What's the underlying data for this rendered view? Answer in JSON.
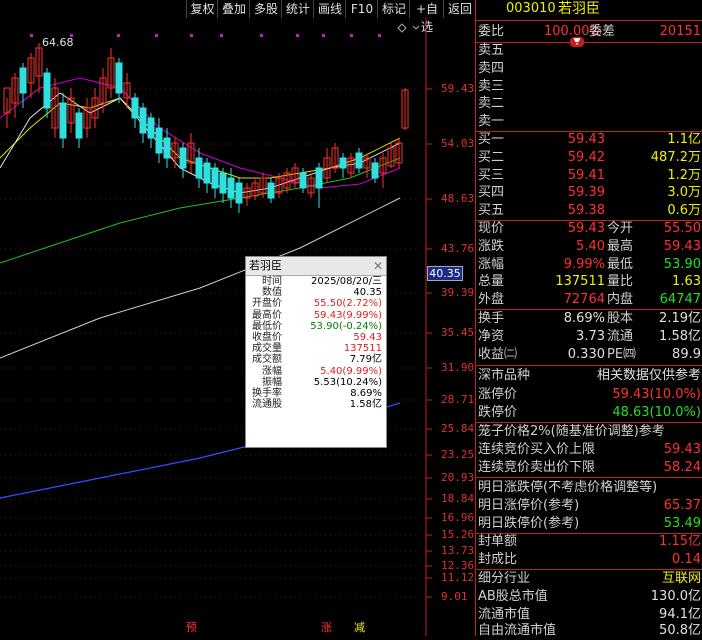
{
  "toolbar": {
    "buttons": [
      "复权",
      "叠加",
      "多股",
      "统计",
      "画线",
      "F10",
      "标记",
      "+自选",
      "返回"
    ]
  },
  "chart": {
    "y_labels": [
      "59.43",
      "54.03",
      "48.63",
      "43.76",
      "39.39",
      "35.45",
      "31.90",
      "28.71",
      "25.84",
      "23.25",
      "20.93",
      "18.84",
      "16.96",
      "15.26",
      "13.73",
      "12.36",
      "11.12",
      "9.01"
    ],
    "current_price": "40.35",
    "high_label": "64.68",
    "markers": [
      {
        "text": "预",
        "color": "#ff3030"
      },
      {
        "text": "涨",
        "color": "#ff3030"
      },
      {
        "text": "减",
        "color": "#f0f000"
      }
    ],
    "tooltip": {
      "title": "若羽臣",
      "rows": [
        {
          "k": "时间",
          "v": "2025/08/20/三",
          "c": "#000"
        },
        {
          "k": "数值",
          "v": "40.35",
          "c": "#000"
        },
        {
          "k": "开盘价",
          "v": "55.50(2.72%)",
          "c": "#e02020"
        },
        {
          "k": "最高价",
          "v": "59.43(9.99%)",
          "c": "#e02020"
        },
        {
          "k": "最低价",
          "v": "53.90(-0.24%)",
          "c": "#008000"
        },
        {
          "k": "收盘价",
          "v": "59.43",
          "c": "#e02020"
        },
        {
          "k": "成交量",
          "v": "137511",
          "c": "#e02020"
        },
        {
          "k": "成交额",
          "v": "7.79亿",
          "c": "#000"
        },
        {
          "k": "涨幅",
          "v": "5.40(9.99%)",
          "c": "#e02020"
        },
        {
          "k": "振幅",
          "v": "5.53(10.24%)",
          "c": "#000"
        },
        {
          "k": "换手率",
          "v": "8.69%",
          "c": "#000"
        },
        {
          "k": "流通股",
          "v": "1.58亿",
          "c": "#000"
        }
      ]
    }
  },
  "panel": {
    "code": "003010",
    "name": "若羽臣",
    "weibi_label": "委比",
    "weibi_value": "100.00%",
    "weicha_label": "委差",
    "weicha_value": "20151",
    "asks": [
      {
        "label": "卖五",
        "price": "",
        "vol": ""
      },
      {
        "label": "卖四",
        "price": "",
        "vol": ""
      },
      {
        "label": "卖三",
        "price": "",
        "vol": ""
      },
      {
        "label": "卖二",
        "price": "",
        "vol": ""
      },
      {
        "label": "卖一",
        "price": "",
        "vol": ""
      }
    ],
    "bids": [
      {
        "label": "买一",
        "price": "59.43",
        "vol": "1.1亿"
      },
      {
        "label": "买二",
        "price": "59.42",
        "vol": "487.2万"
      },
      {
        "label": "买三",
        "price": "59.41",
        "vol": "1.2万"
      },
      {
        "label": "买四",
        "price": "59.39",
        "vol": "3.0万"
      },
      {
        "label": "买五",
        "price": "59.38",
        "vol": "0.6万"
      }
    ],
    "quote": [
      {
        "l1": "现价",
        "v1": "59.43",
        "c1": "red",
        "l2": "今开",
        "v2": "55.50",
        "c2": "red"
      },
      {
        "l1": "涨跌",
        "v1": "5.40",
        "c1": "red",
        "l2": "最高",
        "v2": "59.43",
        "c2": "red"
      },
      {
        "l1": "涨幅",
        "v1": "9.99%",
        "c1": "red",
        "l2": "最低",
        "v2": "53.90",
        "c2": "green"
      },
      {
        "l1": "总量",
        "v1": "137511",
        "c1": "yel",
        "l2": "量比",
        "v2": "1.63",
        "c2": "yel"
      },
      {
        "l1": "外盘",
        "v1": "72764",
        "c1": "red",
        "l2": "内盘",
        "v2": "64747",
        "c2": "green"
      }
    ],
    "stats": [
      {
        "l1": "换手",
        "v1": "8.69%",
        "l2": "股本",
        "v2": "2.19亿"
      },
      {
        "l1": "净资",
        "v1": "3.73",
        "l2": "流通",
        "v2": "1.58亿"
      },
      {
        "l1": "收益㈡",
        "v1": "0.330",
        "l2": "PE㈣",
        "v2": "89.9"
      }
    ],
    "section_a_left": "深市品种",
    "section_a_right": "相关数据仅供参考",
    "limit_up_label": "涨停价",
    "limit_up_value": "59.43(10.0%)",
    "limit_down_label": "跌停价",
    "limit_down_value": "48.63(10.0%)",
    "cage_title": "笼子价格2%(随基准价调整)参考",
    "cage_buy_label": "连续竞价买入价上限",
    "cage_buy_value": "59.43",
    "cage_sell_label": "连续竞价卖出价下限",
    "cage_sell_value": "58.24",
    "next_title": "明日涨跌停(不考虑价格调整等)",
    "next_up_label": "明日涨停价(参考)",
    "next_up_value": "65.37",
    "next_down_label": "明日跌停价(参考)",
    "next_down_value": "53.49",
    "seal_amt_label": "封单额",
    "seal_amt_value": "1.15亿",
    "seal_ratio_label": "封成比",
    "seal_ratio_value": "0.14",
    "industry_label": "细分行业",
    "industry_value": "互联网",
    "ab_cap_label": "AB股总市值",
    "ab_cap_value": "130.0亿",
    "float_cap_label": "流通市值",
    "float_cap_value": "94.1亿",
    "free_cap_label": "自由流通市值",
    "free_cap_value": "50.8亿"
  }
}
